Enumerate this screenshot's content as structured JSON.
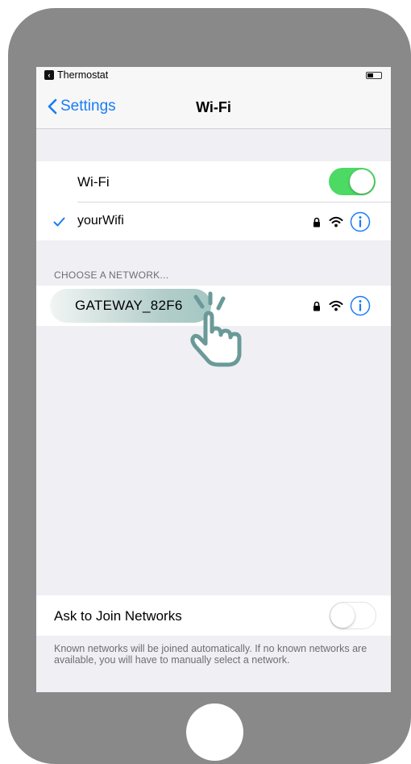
{
  "status_bar": {
    "app": "Thermostat",
    "back_icon": "back-arrow-icon",
    "battery_level": 0.45
  },
  "nav": {
    "back_label": "Settings",
    "title": "Wi-Fi"
  },
  "wifi": {
    "label": "Wi-Fi",
    "enabled": true
  },
  "connected": {
    "name": "yourWifi",
    "checkmark": "checkmark-icon"
  },
  "section_header": "CHOOSE A NETWORK...",
  "networks": [
    {
      "name": "GATEWAY_82F6",
      "secured": true
    }
  ],
  "ask_to_join": {
    "label": "Ask to Join Networks",
    "enabled": false,
    "footer": "Known networks will be joined automatically. If no known networks are available, you will have to manually select a network."
  },
  "colors": {
    "accent": "#1a7cf5",
    "toggle_on": "#4cd964",
    "phone_frame": "#898989",
    "hand": "#6a9a97"
  }
}
